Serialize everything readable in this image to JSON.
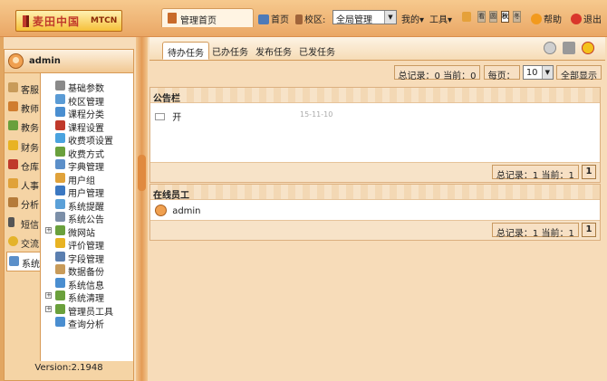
{
  "header": {
    "logo_text": "麦田中国",
    "logo_sub": "MTCN",
    "active_tab": "管理首页",
    "toolbar": {
      "home": "首页",
      "campus_label": "校区:",
      "campus_value": "全局管理",
      "mine": "我的",
      "tools": "工具",
      "mini_buttons": [
        "看",
        "圆",
        "秋",
        "冬"
      ],
      "help": "帮助",
      "logout": "退出"
    }
  },
  "sidebar": {
    "username": "admin",
    "categories": [
      "客服",
      "教师",
      "教务",
      "财务",
      "仓库",
      "人事",
      "分析",
      "短信",
      "交流",
      "系统"
    ],
    "active_category": "系统",
    "menu": [
      {
        "label": "基础参数",
        "expandable": false
      },
      {
        "label": "校区管理",
        "expandable": false
      },
      {
        "label": "课程分类",
        "expandable": false
      },
      {
        "label": "课程设置",
        "expandable": false
      },
      {
        "label": "收费项设置",
        "expandable": false
      },
      {
        "label": "收费方式",
        "expandable": false
      },
      {
        "label": "字典管理",
        "expandable": false
      },
      {
        "label": "用户组",
        "expandable": false
      },
      {
        "label": "用户管理",
        "expandable": false
      },
      {
        "label": "系统提醒",
        "expandable": false
      },
      {
        "label": "系统公告",
        "expandable": false
      },
      {
        "label": "微网站",
        "expandable": true
      },
      {
        "label": "评价管理",
        "expandable": false
      },
      {
        "label": "字段管理",
        "expandable": false
      },
      {
        "label": "数据备份",
        "expandable": false
      },
      {
        "label": "系统信息",
        "expandable": false
      },
      {
        "label": "系统清理",
        "expandable": true
      },
      {
        "label": "管理员工具",
        "expandable": true
      },
      {
        "label": "查询分析",
        "expandable": false
      }
    ],
    "version": "Version:2.1948"
  },
  "main": {
    "tabs": [
      "待办任务",
      "已办任务",
      "发布任务",
      "已发任务"
    ],
    "active_tab": "待办任务",
    "pager": {
      "summary": "总记录：0  当前：0",
      "page_size_label": "每页：",
      "page_size_value": "10",
      "show_all": "全部显示"
    },
    "announcements": {
      "title": "公告栏",
      "items": [
        {
          "title": "开",
          "date": "15-11-10"
        }
      ],
      "summary": "总记录：1  当前：1",
      "page": "1"
    },
    "online": {
      "title": "在线员工",
      "users": [
        "admin"
      ],
      "summary": "总记录：1  当前：1",
      "page": "1"
    }
  }
}
